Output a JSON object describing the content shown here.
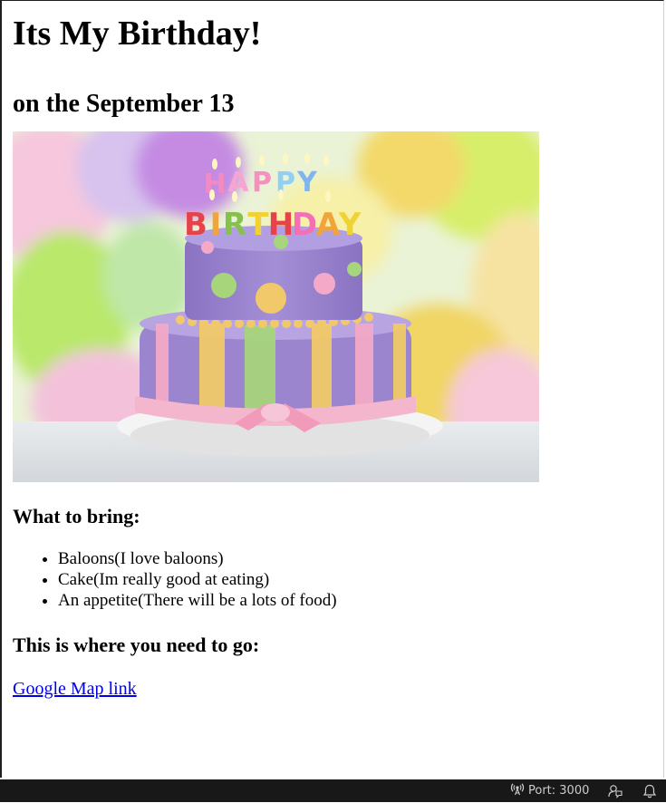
{
  "page": {
    "title": "Its My Birthday!",
    "subtitle": "on the September 13"
  },
  "image": {
    "alt": "Birthday cake",
    "candle_letters": [
      "H",
      "A",
      "P",
      "P",
      "Y",
      "B",
      "I",
      "R",
      "T",
      "H",
      "D",
      "A",
      "Y"
    ]
  },
  "bring": {
    "heading": "What to bring:",
    "items": [
      "Baloons(I love baloons)",
      "Cake(Im really good at eating)",
      "An appetite(There will be a lots of food)"
    ]
  },
  "location": {
    "heading": "This is where you need to go:",
    "link_text": "Google Map link"
  },
  "statusbar": {
    "port_text": "Port: 3000",
    "port_icon": "broadcast-icon",
    "feedback_icon": "feedback-icon",
    "bell_icon": "bell-icon"
  },
  "colors": {
    "link": "#0000ee",
    "statusbar_bg": "#181818",
    "cake_purple": "#9b85cf",
    "ribbon_pink": "#f4b6cc"
  }
}
